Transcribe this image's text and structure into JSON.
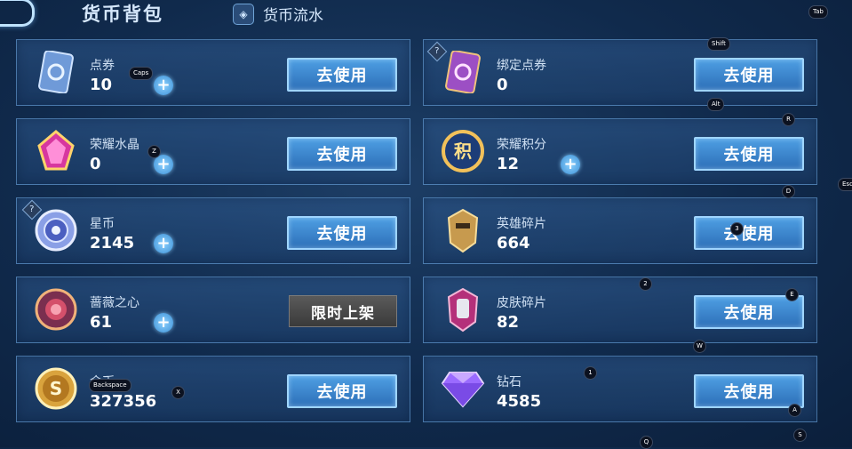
{
  "header": {
    "title": "货币背包",
    "ledger_label": "货币流水"
  },
  "button_labels": {
    "use": "去使用",
    "limited": "限时上架"
  },
  "left_items": [
    {
      "name": "点券",
      "value": "10",
      "icon": "voucher-card-icon"
    },
    {
      "name": "荣耀水晶",
      "value": "0",
      "icon": "glory-crystal-icon"
    },
    {
      "name": "星币",
      "value": "2145",
      "icon": "star-coin-icon"
    },
    {
      "name": "蔷薇之心",
      "value": "61",
      "icon": "rose-heart-icon"
    },
    {
      "name": "金币",
      "value": "327356",
      "icon": "gold-coin-icon"
    }
  ],
  "right_items": [
    {
      "name": "绑定点券",
      "value": "0",
      "icon": "bound-voucher-icon"
    },
    {
      "name": "荣耀积分",
      "value": "12",
      "icon": "glory-points-icon"
    },
    {
      "name": "英雄碎片",
      "value": "664",
      "icon": "hero-fragment-icon"
    },
    {
      "name": "皮肤碎片",
      "value": "82",
      "icon": "skin-fragment-icon"
    },
    {
      "name": "钻石",
      "value": "4585",
      "icon": "diamond-icon"
    }
  ],
  "key_hints": {
    "tab": "Tab",
    "shift": "Shift",
    "alt": "Alt",
    "caps": "Caps",
    "r": "R",
    "d": "D",
    "e": "E",
    "w": "W",
    "z": "Z",
    "x": "X",
    "q": "Q",
    "a": "A",
    "s": "S",
    "one": "1",
    "two": "2",
    "three": "3",
    "backspace": "Backspace",
    "esc": "Esc"
  },
  "colors": {
    "accent": "#4e9fe3",
    "card_border": "#6ea5dc",
    "background": "#102a4c"
  }
}
